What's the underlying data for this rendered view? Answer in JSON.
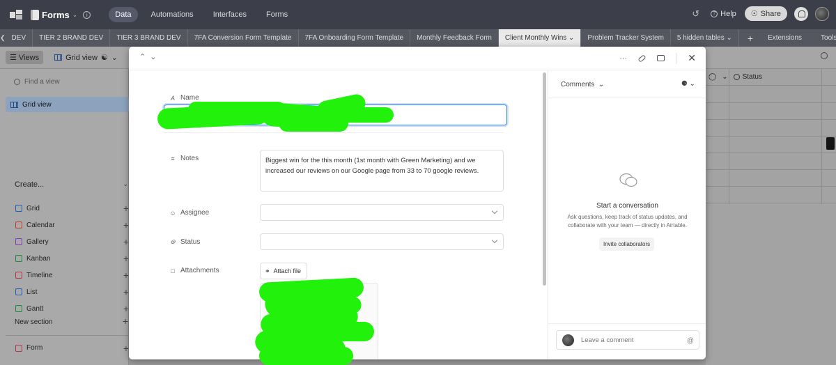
{
  "topbar": {
    "base_name": "Forms",
    "nav": [
      "Data",
      "Automations",
      "Interfaces",
      "Forms"
    ],
    "help": "Help",
    "share": "Share"
  },
  "tabs": {
    "items": [
      "DEV",
      "TIER 2 BRAND DEV",
      "TIER 3 BRAND DEV",
      "7FA Conversion Form Template",
      "7FA Onboarding Form Template",
      "Monthly Feedback Form",
      "Client Monthly Wins",
      "Problem Tracker System",
      "5 hidden tables"
    ],
    "active_index": 6,
    "extensions": "Extensions",
    "tools": "Tools"
  },
  "viewbar": {
    "views": "Views",
    "grid_view": "Grid view"
  },
  "sidebar": {
    "find_placeholder": "Find a view",
    "active_view": "Grid view",
    "create": "Create...",
    "view_types": [
      {
        "label": "Grid",
        "color": "#1e5fb4"
      },
      {
        "label": "Calendar",
        "color": "#c0392b"
      },
      {
        "label": "Gallery",
        "color": "#7d3cb5"
      },
      {
        "label": "Kanban",
        "color": "#188a3c"
      },
      {
        "label": "Timeline",
        "color": "#b7324a"
      },
      {
        "label": "List",
        "color": "#1e5fb4"
      },
      {
        "label": "Gantt",
        "color": "#188a3c"
      }
    ],
    "new_section": "New section",
    "form": "Form"
  },
  "grid": {
    "status_header": "Status"
  },
  "record": {
    "fields": {
      "name_label": "Name",
      "notes_label": "Notes",
      "notes_value": "Biggest win for the this month (1st month with Green Marketing) and we increased our reviews on our Google page from 33 to 70 google reviews.",
      "assignee_label": "Assignee",
      "status_label": "Status",
      "attachments_label": "Attachments",
      "attach_button": "Attach file"
    }
  },
  "comments": {
    "header": "Comments",
    "title": "Start a conversation",
    "text": "Ask questions, keep track of status updates, and collaborate with your team — directly in Airtable.",
    "invite": "Invite collaborators",
    "placeholder": "Leave a comment",
    "at_symbol": "@"
  },
  "colors": {
    "topbar": "#3c3f4a",
    "focus_blue": "#2d7ff9",
    "redaction_green": "#22f10b"
  }
}
